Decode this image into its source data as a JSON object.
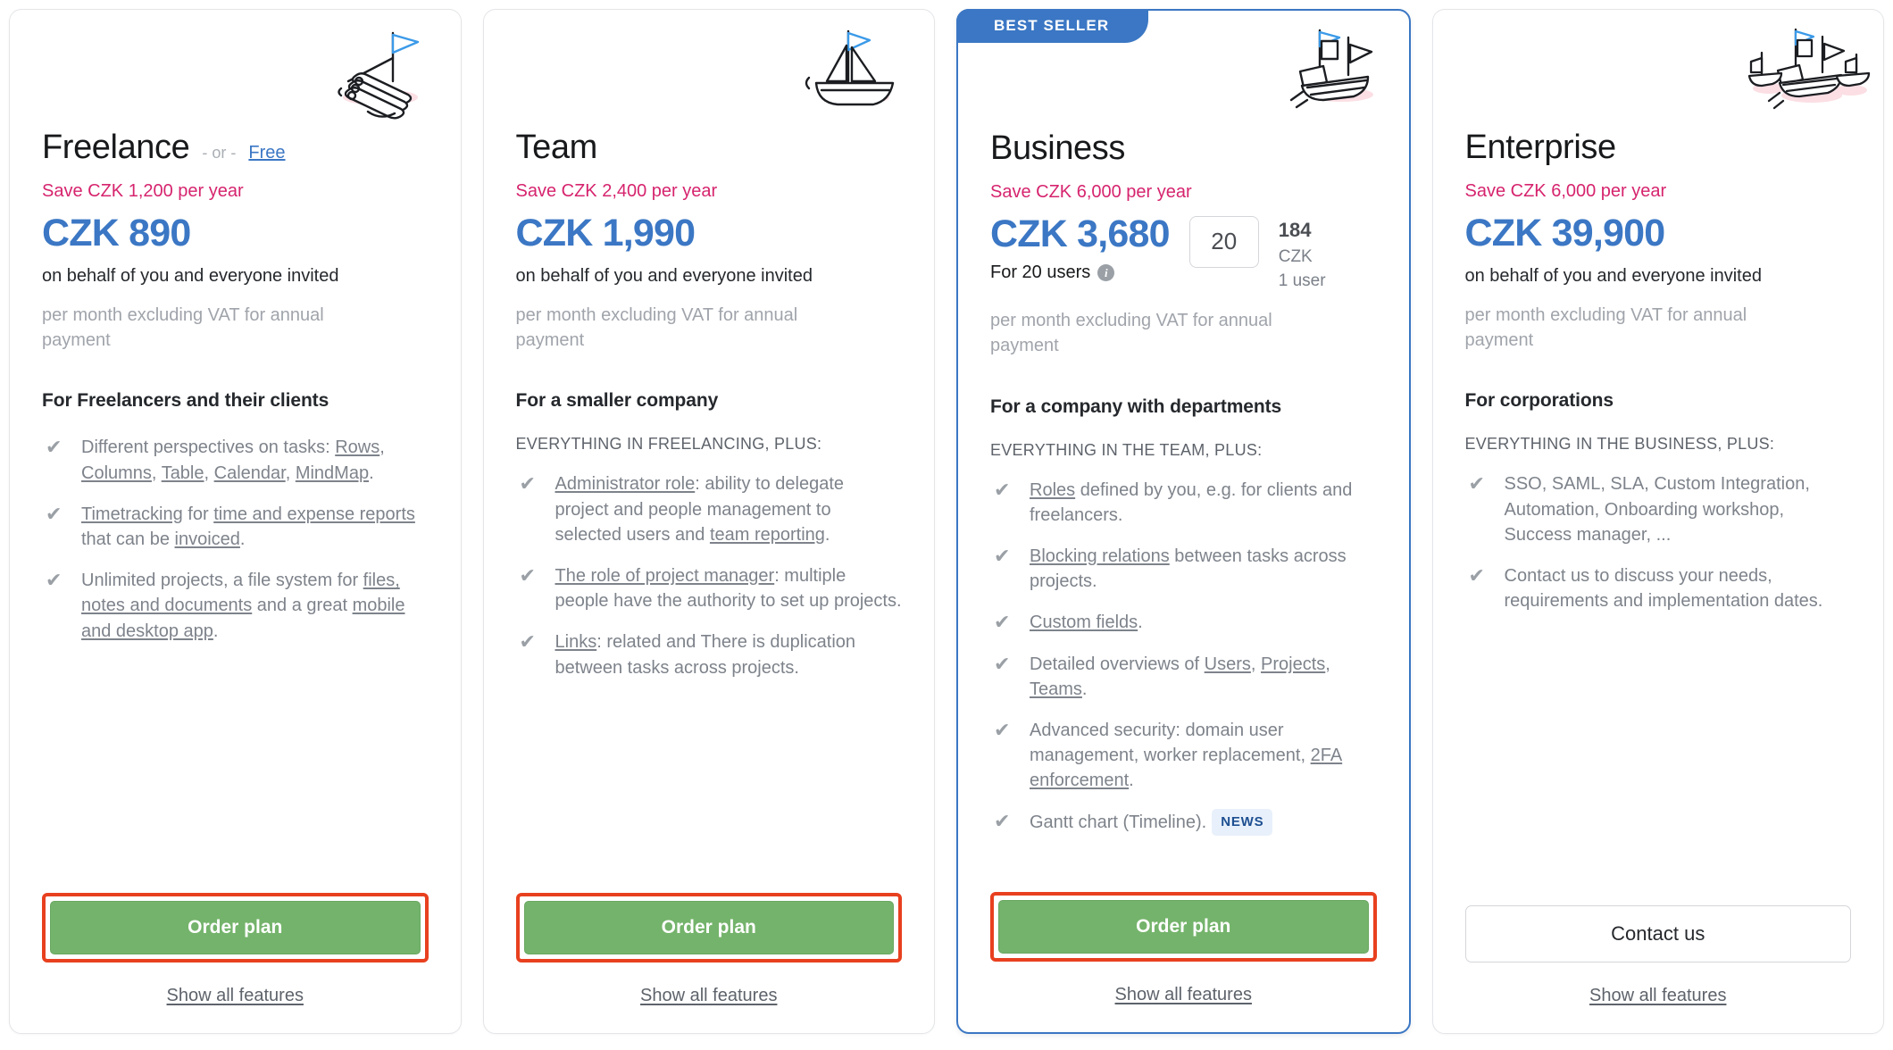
{
  "plans": [
    {
      "name": "Freelance",
      "or_label": "- or -",
      "alt_link": "Free",
      "save": "Save CZK 1,200 per year",
      "price": "CZK 890",
      "behalf": "on behalf of you and everyone invited",
      "note": "per month excluding VAT for annual payment",
      "features_head": "For Freelancers and their clients",
      "kicker": "",
      "features": [
        "Different perspectives on tasks: Rows, Columns, Table, Calendar, MindMap.",
        "Timetracking for time and expense reports that can be invoiced.",
        "Unlimited projects, a file system for files, notes and documents and a great mobile and desktop app."
      ],
      "cta": "Order plan",
      "cta_style": "order",
      "highlight": true,
      "show_all": "Show all features",
      "icon": "raft-illustration"
    },
    {
      "name": "Team",
      "or_label": "",
      "alt_link": "",
      "save": "Save CZK 2,400 per year",
      "price": "CZK 1,990",
      "behalf": "on behalf of you and everyone invited",
      "note": "per month excluding VAT for annual payment",
      "features_head": "For a smaller company",
      "kicker": "EVERYTHING IN FREELANCING, PLUS:",
      "features": [
        "Administrator role: ability to delegate project and people management to selected users and team reporting.",
        "The role of project manager: multiple people have the authority to set up projects.",
        "Links: related and There is duplication between tasks across projects."
      ],
      "cta": "Order plan",
      "cta_style": "order",
      "highlight": true,
      "show_all": "Show all features",
      "icon": "sailboat-illustration"
    },
    {
      "name": "Business",
      "badge": "BEST SELLER",
      "or_label": "",
      "alt_link": "",
      "save": "Save CZK 6,000 per year",
      "price": "CZK 3,680",
      "price_sub": "For 20 users",
      "seats": "20",
      "unit_amount": "184",
      "unit_currency": "CZK",
      "unit_per": "1 user",
      "behalf": "",
      "note": "per month excluding VAT for annual payment",
      "features_head": "For a company with departments",
      "kicker": "EVERYTHING IN THE TEAM, PLUS:",
      "features": [
        "Roles defined by you, e.g. for clients and freelancers.",
        "Blocking relations between tasks across projects.",
        "Custom fields.",
        "Detailed overviews of Users, Projects, Teams.",
        "Advanced security: domain user management, worker replacement, 2FA enforcement.",
        "Gantt chart (Timeline)."
      ],
      "news_badge": "NEWS",
      "cta": "Order plan",
      "cta_style": "order",
      "highlight": true,
      "show_all": "Show all features",
      "icon": "ship-illustration"
    },
    {
      "name": "Enterprise",
      "or_label": "",
      "alt_link": "",
      "save": "Save CZK 6,000 per year",
      "price": "CZK 39,900",
      "behalf": "on behalf of you and everyone invited",
      "note": "per month excluding VAT for annual payment",
      "features_head": "For corporations",
      "kicker": "EVERYTHING IN THE BUSINESS, PLUS:",
      "features": [
        "SSO, SAML, SLA, Custom Integration, Automation, Onboarding workshop, Success manager, ...",
        "Contact us to discuss your needs, requirements and implementation dates."
      ],
      "cta": "Contact us",
      "cta_style": "contact",
      "highlight": false,
      "show_all": "Show all features",
      "icon": "fleet-illustration"
    }
  ],
  "colors": {
    "price_blue": "#3b77c4",
    "save_pink": "#d6246e",
    "cta_green": "#74b36b",
    "highlight_red": "#e8401f",
    "badge_blue": "#3b77c4",
    "news_badge_bg": "#e8f0fb",
    "news_badge_text": "#1d4f91"
  }
}
